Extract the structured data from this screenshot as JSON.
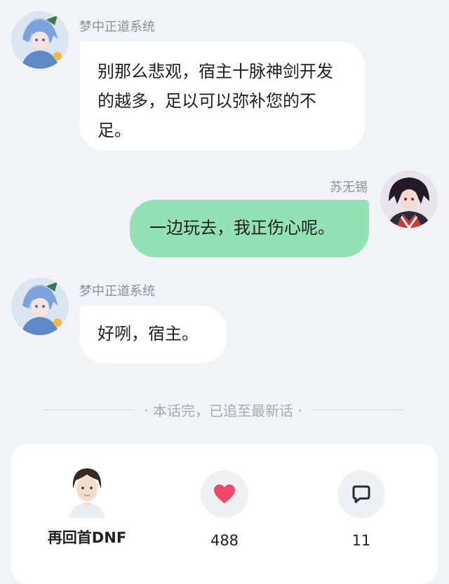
{
  "messages": [
    {
      "sender": "梦中正道系统",
      "text": "别那么悲观，宿主十脉神剑开发的越多，足以可以弥补您的不足。",
      "side": "left"
    },
    {
      "sender": "苏无锡",
      "text": "一边玩去，我正伤心呢。",
      "side": "right"
    },
    {
      "sender": "梦中正道系统",
      "text": "好咧，宿主。",
      "side": "left"
    }
  ],
  "end_notice": "· 本话完，已追至最新话 ·",
  "bottom_bar": {
    "author_name": "再回首DNF",
    "like_count": "488",
    "comment_count": "11"
  },
  "colors": {
    "page_background": "#f2f3f7",
    "left_bubble": "#ffffff",
    "right_bubble": "#93e2b4",
    "heart": "#f0486b"
  },
  "icons": {
    "like": "heart-icon",
    "comment": "comment-icon"
  }
}
